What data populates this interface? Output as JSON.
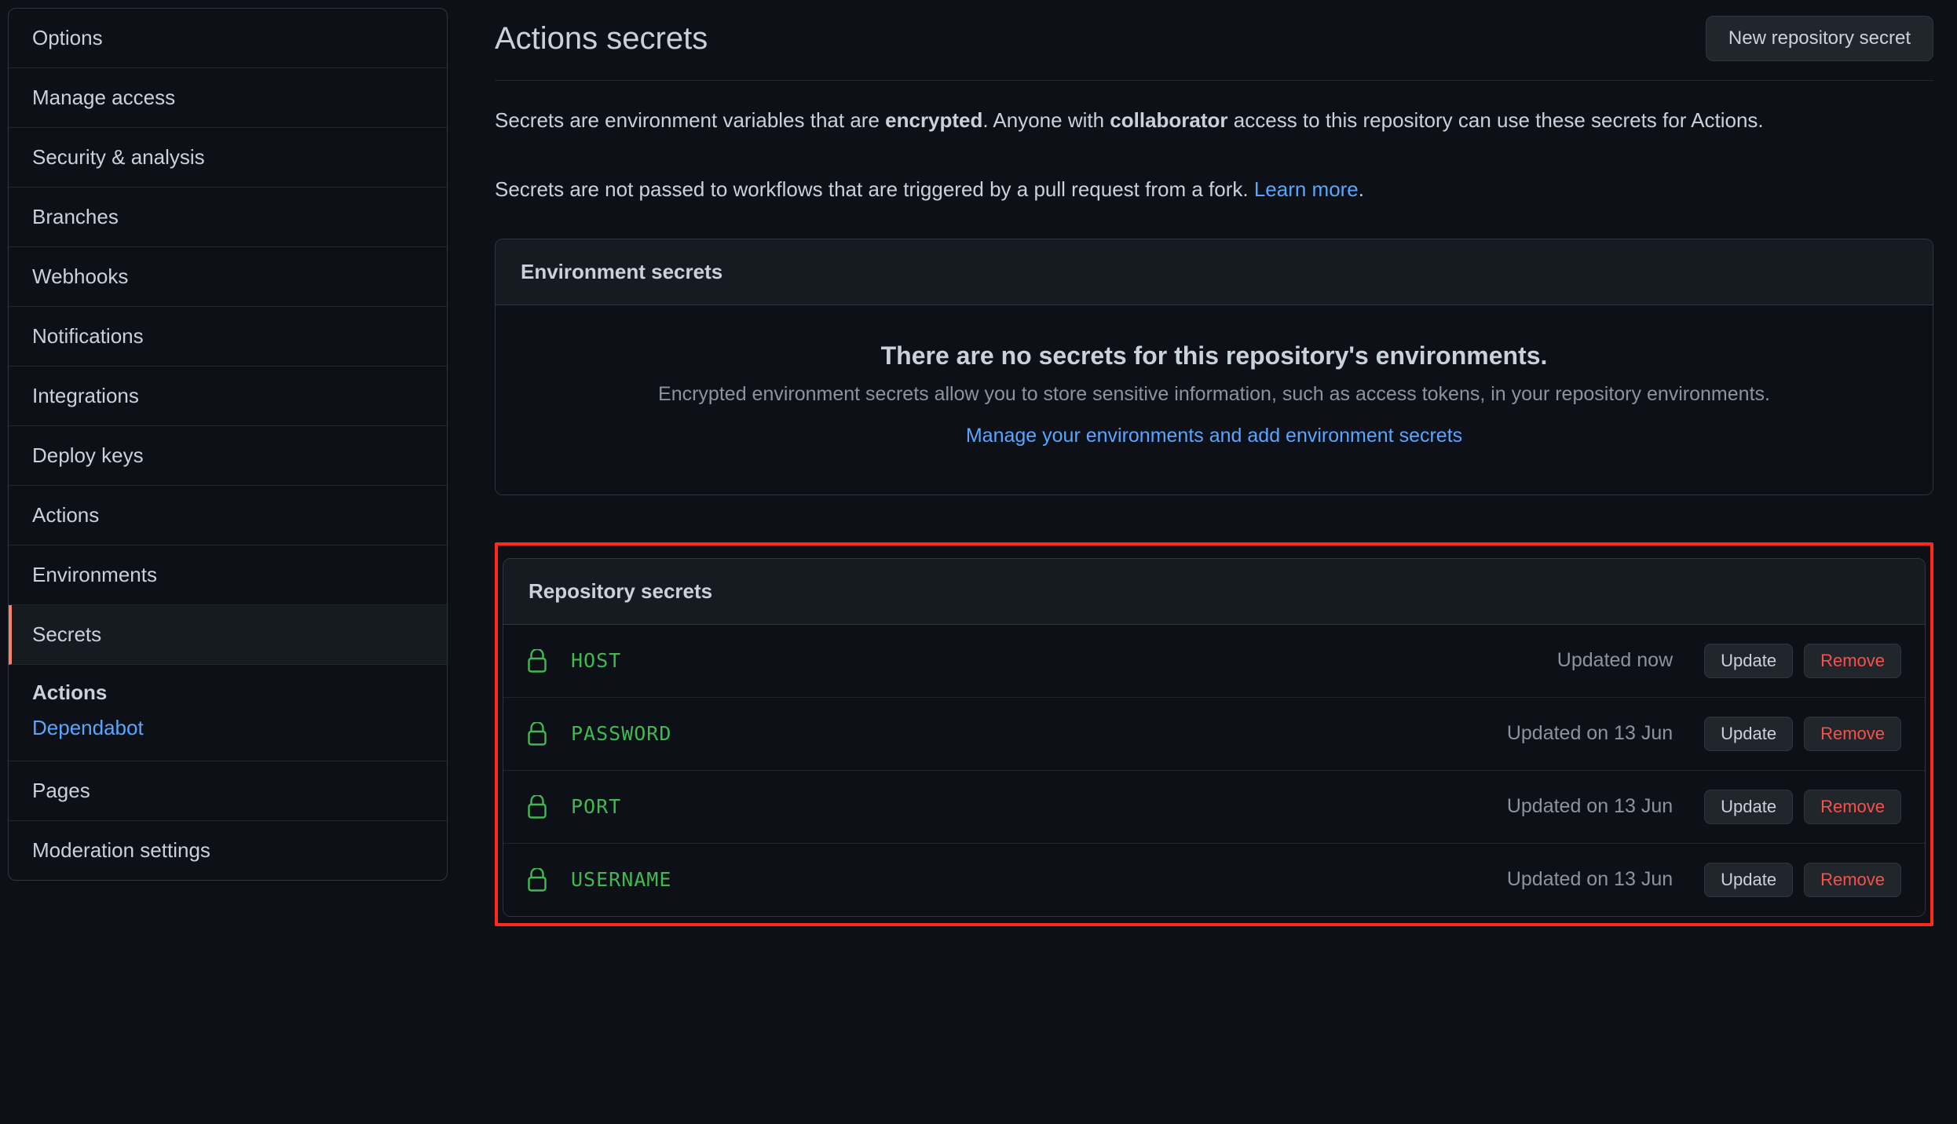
{
  "sidebar": {
    "items": [
      {
        "label": "Options"
      },
      {
        "label": "Manage access"
      },
      {
        "label": "Security & analysis"
      },
      {
        "label": "Branches"
      },
      {
        "label": "Webhooks"
      },
      {
        "label": "Notifications"
      },
      {
        "label": "Integrations"
      },
      {
        "label": "Deploy keys"
      },
      {
        "label": "Actions"
      },
      {
        "label": "Environments"
      },
      {
        "label": "Secrets"
      }
    ],
    "secrets_sub": {
      "heading": "Actions",
      "link": "Dependabot"
    },
    "tail": [
      {
        "label": "Pages"
      },
      {
        "label": "Moderation settings"
      }
    ]
  },
  "header": {
    "title": "Actions secrets",
    "new_button": "New repository secret"
  },
  "intro": {
    "p1a": "Secrets are environment variables that are ",
    "p1b": "encrypted",
    "p1c": ". Anyone with ",
    "p1d": "collaborator",
    "p1e": " access to this repository can use these secrets for Actions.",
    "p2a": "Secrets are not passed to workflows that are triggered by a pull request from a fork. ",
    "learn_more": "Learn more",
    "p2b": "."
  },
  "env_panel": {
    "header": "Environment secrets",
    "empty_title": "There are no secrets for this repository's environments.",
    "empty_desc": "Encrypted environment secrets allow you to store sensitive information, such as access tokens, in your repository environments.",
    "empty_link": "Manage your environments and add environment secrets"
  },
  "repo_panel": {
    "header": "Repository secrets",
    "update_label": "Update",
    "remove_label": "Remove",
    "secrets": [
      {
        "name": "HOST",
        "updated": "Updated now"
      },
      {
        "name": "PASSWORD",
        "updated": "Updated on 13 Jun"
      },
      {
        "name": "PORT",
        "updated": "Updated on 13 Jun"
      },
      {
        "name": "USERNAME",
        "updated": "Updated on 13 Jun"
      }
    ]
  },
  "colors": {
    "accent_link": "#58a6ff",
    "secret_green": "#3fb950",
    "danger": "#f85149",
    "sidebar_selected_marker": "#f78166",
    "highlight_border": "#ff2a1a"
  }
}
